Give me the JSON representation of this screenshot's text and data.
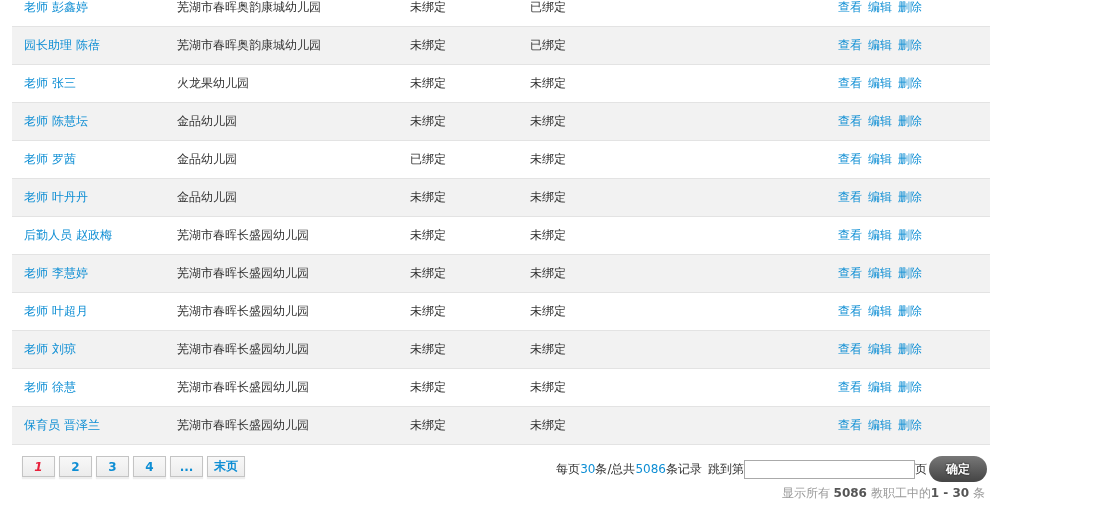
{
  "table": {
    "rows": [
      {
        "name": "老师 彭鑫婷",
        "school": "芜湖市春晖奥韵康城幼儿园",
        "column_3": "未绑定",
        "column_4": "已绑定",
        "actions": [
          "查看",
          "编辑",
          "删除"
        ]
      },
      {
        "name": "园长助理 陈蓓",
        "school": "芜湖市春晖奥韵康城幼儿园",
        "column_3": "未绑定",
        "column_4": "已绑定",
        "actions": [
          "查看",
          "编辑",
          "删除"
        ]
      },
      {
        "name": "老师 张三",
        "school": "火龙果幼儿园",
        "column_3": "未绑定",
        "column_4": "未绑定",
        "actions": [
          "查看",
          "编辑",
          "删除"
        ]
      },
      {
        "name": "老师 陈慧坛",
        "school": "金品幼儿园",
        "column_3": "未绑定",
        "column_4": "未绑定",
        "actions": [
          "查看",
          "编辑",
          "删除"
        ]
      },
      {
        "name": "老师 罗茜",
        "school": "金品幼儿园",
        "column_3": "已绑定",
        "column_4": "未绑定",
        "actions": [
          "查看",
          "编辑",
          "删除"
        ]
      },
      {
        "name": "老师 叶丹丹",
        "school": "金品幼儿园",
        "column_3": "未绑定",
        "column_4": "未绑定",
        "actions": [
          "查看",
          "编辑",
          "删除"
        ]
      },
      {
        "name": "后勤人员 赵政梅",
        "school": "芜湖市春晖长盛园幼儿园",
        "column_3": "未绑定",
        "column_4": "未绑定",
        "actions": [
          "查看",
          "编辑",
          "删除"
        ]
      },
      {
        "name": "老师 李慧婷",
        "school": "芜湖市春晖长盛园幼儿园",
        "column_3": "未绑定",
        "column_4": "未绑定",
        "actions": [
          "查看",
          "编辑",
          "删除"
        ]
      },
      {
        "name": "老师 叶超月",
        "school": "芜湖市春晖长盛园幼儿园",
        "column_3": "未绑定",
        "column_4": "未绑定",
        "actions": [
          "查看",
          "编辑",
          "删除"
        ]
      },
      {
        "name": "老师 刘琼",
        "school": "芜湖市春晖长盛园幼儿园",
        "column_3": "未绑定",
        "column_4": "未绑定",
        "actions": [
          "查看",
          "编辑",
          "删除"
        ]
      },
      {
        "name": "老师 徐慧",
        "school": "芜湖市春晖长盛园幼儿园",
        "column_3": "未绑定",
        "column_4": "未绑定",
        "actions": [
          "查看",
          "编辑",
          "删除"
        ]
      },
      {
        "name": "保育员 晋泽兰",
        "school": "芜湖市春晖长盛园幼儿园",
        "column_3": "未绑定",
        "column_4": "未绑定",
        "actions": [
          "查看",
          "编辑",
          "删除"
        ]
      }
    ]
  },
  "pagination": {
    "pages": [
      {
        "label": "1",
        "selected": true
      },
      {
        "label": "2",
        "selected": false
      },
      {
        "label": "3",
        "selected": false
      },
      {
        "label": "4",
        "selected": false
      },
      {
        "label": "...",
        "selected": false
      },
      {
        "label": "末页",
        "selected": false
      }
    ],
    "page_info": [
      "每页",
      "30",
      "条/总共",
      "5086",
      "条记录"
    ],
    "jump_label": "跳到第",
    "jump_suffix": "页",
    "confirm_button": "确定",
    "summary": "显示所有 **5086** 教职工中的**1 - 30** 条"
  }
}
